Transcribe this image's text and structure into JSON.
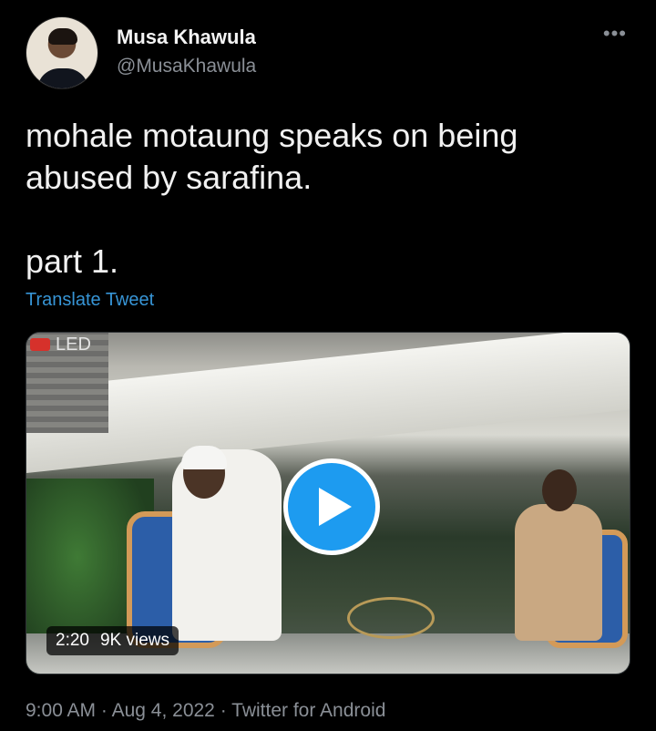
{
  "author": {
    "name": "Musa Khawula",
    "handle": "@MusaKhawula",
    "avatar_icon": "user-avatar"
  },
  "tweet": {
    "text": "mohale motaung speaks on being abused by sarafina.\n\npart 1.",
    "translate_label": "Translate Tweet"
  },
  "media": {
    "watermark": "LED",
    "duration": "2:20",
    "views": "9K views",
    "play_icon": "play-icon"
  },
  "meta": {
    "time": "9:00 AM",
    "date": "Aug 4, 2022",
    "source": "Twitter for Android",
    "separator": "·"
  },
  "more_icon": "more-horizontal-icon",
  "colors": {
    "background": "#000000",
    "link": "#3795d6",
    "play": "#1d9bf0",
    "muted": "#8a8f96"
  }
}
